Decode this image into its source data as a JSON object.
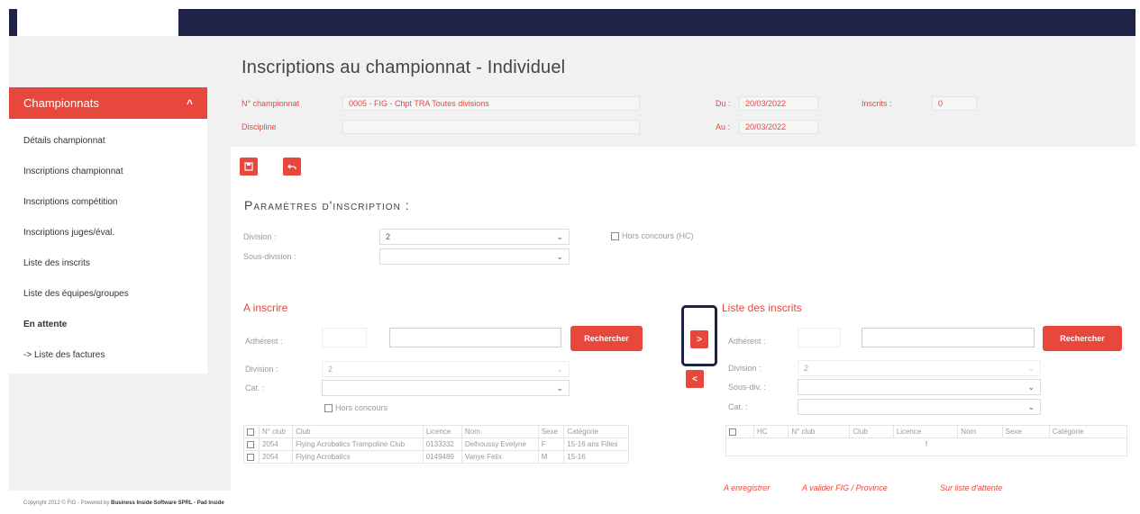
{
  "page": {
    "title": "Inscriptions au championnat - Individuel"
  },
  "sidebar": {
    "header": "Championnats",
    "items": [
      {
        "label": "Détails championnat",
        "active": false
      },
      {
        "label": "Inscriptions championnat",
        "active": false
      },
      {
        "label": "Inscriptions compétition",
        "active": false
      },
      {
        "label": "Inscriptions juges/éval.",
        "active": false
      },
      {
        "label": "Liste des inscrits",
        "active": false
      },
      {
        "label": "Liste des équipes/groupes",
        "active": false
      },
      {
        "label": "En attente",
        "active": true
      },
      {
        "label": "-> Liste des factures",
        "active": false
      }
    ]
  },
  "championship": {
    "number_label": "N° championnat",
    "number_value": "0005 - FIG - Chpt TRA Toutes divisions",
    "discipline_label": "Discipline",
    "discipline_value": "",
    "du_label": "Du :",
    "du_value": "20/03/2022",
    "au_label": "Au :",
    "au_value": "20/03/2022",
    "inscrits_label": "Inscrits :",
    "inscrits_value": "0"
  },
  "params": {
    "title": "Paramètres d'inscription :",
    "division_label": "Division :",
    "division_value": "2",
    "subdivision_label": "Sous-division :",
    "subdivision_value": "",
    "hors_concours_label": "Hors concours (HC)"
  },
  "left_panel": {
    "title": "A inscrire",
    "adherent_label": "Adhérent :",
    "search_button": "Rechercher",
    "division_label": "Division :",
    "division_value": "2",
    "cat_label": "Cat. :",
    "hors_concours_label": "Hors concours",
    "columns": [
      "N° club",
      "Club",
      "Licence",
      "Nom",
      "Sexe",
      "Catégorie"
    ],
    "rows": [
      {
        "club_no": "2054",
        "club": "Flying Acrobatics Trampoline Club",
        "licence": "0133332",
        "nom": "Delhoussy Evelyne",
        "sexe": "F",
        "categorie": "15-16 ans Filles"
      },
      {
        "club_no": "2054",
        "club": "Flying Acrobatics",
        "licence": "0149489",
        "nom": "Vanye Felix",
        "sexe": "M",
        "categorie": "15-16"
      }
    ]
  },
  "right_panel": {
    "title": "Liste des inscrits",
    "adherent_label": "Adhérent :",
    "search_button": "Rechercher",
    "division_label": "Division :",
    "division_value": "2",
    "subdiv_label": "Sous-div. :",
    "cat_label": "Cat. :",
    "columns": [
      "HC",
      "N° club",
      "Club",
      "Licence",
      "Nom",
      "Sexe",
      "Catégorie"
    ],
    "empty_value": "!",
    "links": [
      "A enregistrer",
      "A valider FIG / Province",
      "Sur liste d'attente"
    ]
  },
  "transfer": {
    "add_symbol": ">",
    "remove_symbol": "<"
  },
  "footer": {
    "prefix": "Copyright 2012 © FIG - Powered by",
    "brand": "Business Inside Software SPRL - Pad Inside"
  },
  "colors": {
    "accent": "#e8473e",
    "navy": "#1f2247",
    "background": "#f1f1f1"
  },
  "icons": {
    "save": "save-icon",
    "undo": "undo-icon",
    "collapse": "chevron-up-icon"
  }
}
